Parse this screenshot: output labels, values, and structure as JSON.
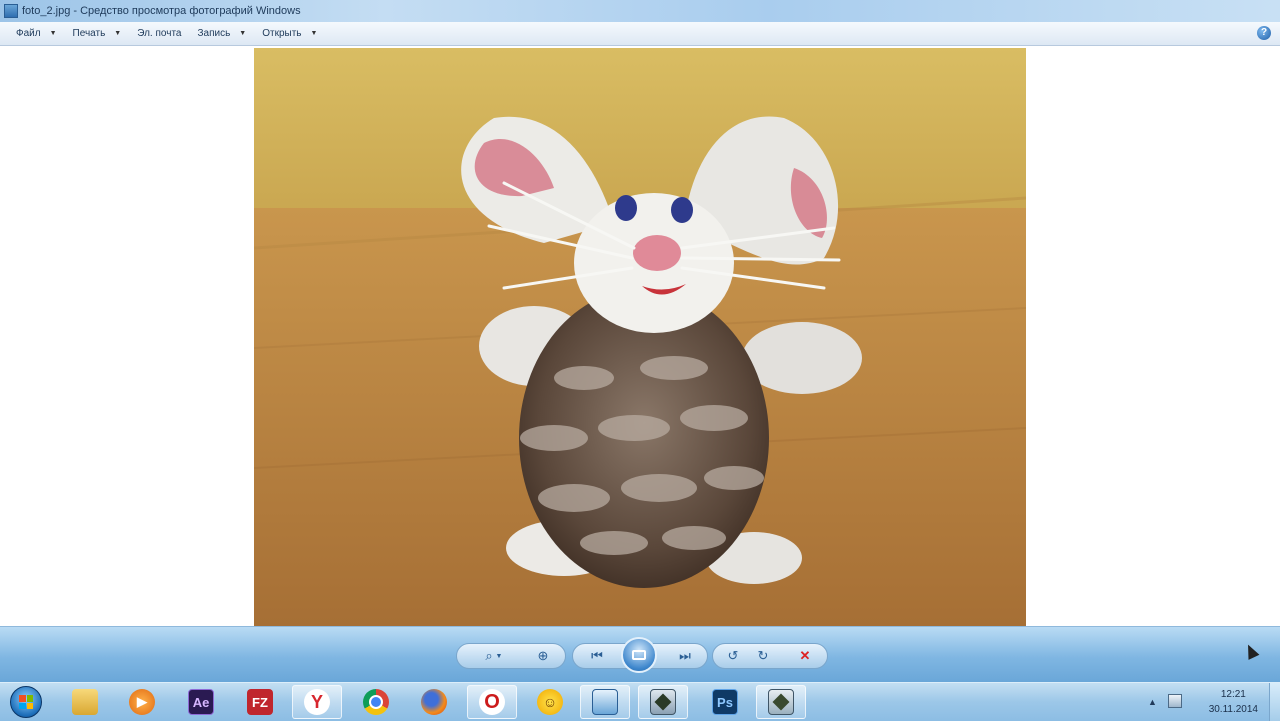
{
  "window": {
    "title": "foto_2.jpg - Средство просмотра фотографий Windows"
  },
  "menu": {
    "items": [
      {
        "label": "Файл",
        "has_dropdown": true
      },
      {
        "label": "Печать",
        "has_dropdown": true
      },
      {
        "label": "Эл. почта",
        "has_dropdown": false
      },
      {
        "label": "Запись",
        "has_dropdown": true
      },
      {
        "label": "Открыть",
        "has_dropdown": true
      }
    ],
    "help_label": "?"
  },
  "controls": {
    "icons": [
      "zoom-icon",
      "fit-to-window-icon",
      "previous-icon",
      "slideshow-icon",
      "next-icon",
      "rotate-left-icon",
      "rotate-right-icon",
      "delete-icon"
    ]
  },
  "taskbar": {
    "items": [
      {
        "name": "explorer",
        "icon": "folder-icon"
      },
      {
        "name": "media-player",
        "icon": "media-player-icon"
      },
      {
        "name": "after-effects",
        "label": "Ae",
        "icon": "after-effects-icon",
        "color": "#2a1a52"
      },
      {
        "name": "filezilla",
        "label": "FZ",
        "icon": "filezilla-icon",
        "color": "#c0262d"
      },
      {
        "name": "yandex-browser",
        "label": "Y",
        "icon": "yandex-browser-icon",
        "color": "#d7262d"
      },
      {
        "name": "chrome",
        "icon": "chrome-icon"
      },
      {
        "name": "firefox",
        "icon": "firefox-icon"
      },
      {
        "name": "opera",
        "label": "O",
        "icon": "opera-icon",
        "color": "#cc1b1b"
      },
      {
        "name": "emoji-app",
        "icon": "smiley-icon"
      },
      {
        "name": "photo-viewer",
        "icon": "photo-viewer-icon"
      },
      {
        "name": "slides-app",
        "icon": "slides-icon"
      },
      {
        "name": "photoshop",
        "label": "Ps",
        "icon": "photoshop-icon",
        "color": "#0f3a66"
      },
      {
        "name": "game-app",
        "icon": "game-icon"
      }
    ],
    "clock": {
      "time": "12:21",
      "date": "30.11.2014"
    }
  }
}
